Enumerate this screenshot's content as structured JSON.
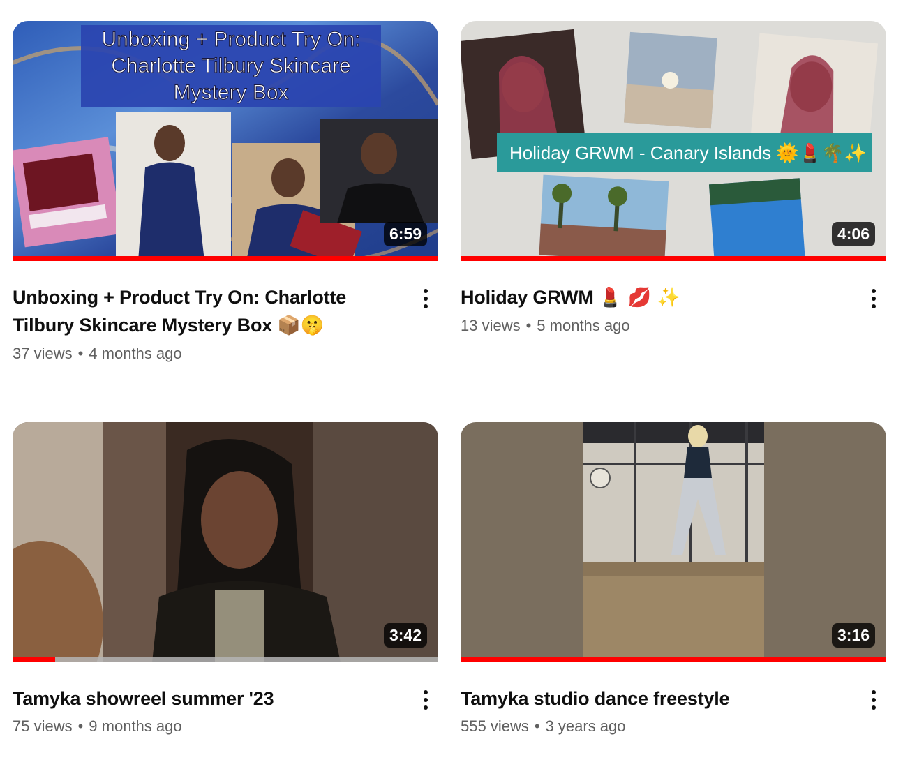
{
  "videos": [
    {
      "title": "Unboxing + Product Try On: Charlotte Tilbury Skincare Mystery Box",
      "title_emoji": "📦🤫",
      "views": "37 views",
      "age": "4 months ago",
      "duration": "6:59",
      "watched_fraction": 1.0,
      "thumbnail_text": {
        "line1": "Unboxing + Product Try On:",
        "line2": "Charlotte Tilbury Skincare",
        "line3": "Mystery Box"
      }
    },
    {
      "title": "Holiday GRWM",
      "title_emoji": "💄 💋 ✨",
      "views": "13 views",
      "age": "5 months ago",
      "duration": "4:06",
      "watched_fraction": 1.0,
      "thumbnail_text": {
        "banner": "Holiday GRWM - Canary Islands 🌞💄🌴✨"
      }
    },
    {
      "title": "Tamyka showreel summer '23",
      "title_emoji": "",
      "views": "75 views",
      "age": "9 months ago",
      "duration": "3:42",
      "watched_fraction": 0.1
    },
    {
      "title": "Tamyka studio dance freestyle",
      "title_emoji": "",
      "views": "555 views",
      "age": "3 years ago",
      "duration": "3:16",
      "watched_fraction": 1.0
    }
  ],
  "separator": "•",
  "icons": {
    "more": "more-vert-icon"
  },
  "colors": {
    "progress": "#ff0000",
    "meta_text": "#606060"
  }
}
